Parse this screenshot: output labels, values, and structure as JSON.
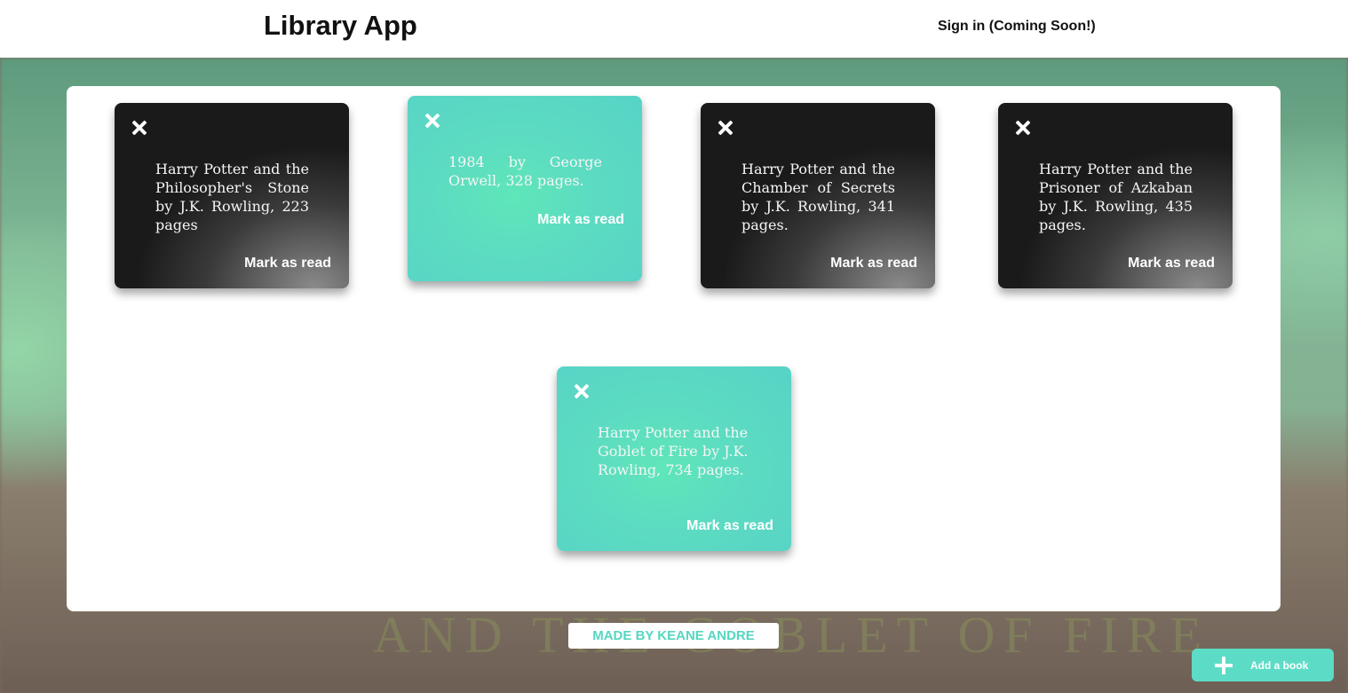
{
  "header": {
    "title": "Library App",
    "sign_in": "Sign in (Coming Soon!)"
  },
  "background": {
    "text": "AND THE GOBLET OF FIRE"
  },
  "books": [
    {
      "text": "Harry Potter and the Philosopher's Stone by J.K. Rowling, 223 pages",
      "action": "Mark as read",
      "status": "unread"
    },
    {
      "text": "1984 by George Orwell, 328 pages.",
      "action": "Mark as read",
      "status": "read"
    },
    {
      "text": "Harry Potter and the Chamber of Secrets by J.K. Rowling, 341 pages.",
      "action": "Mark as read",
      "status": "unread"
    },
    {
      "text": "Harry Potter and the Prisoner of Azkaban by J.K. Rowling, 435 pages.",
      "action": "Mark as read",
      "status": "unread"
    },
    {
      "text": "Harry Potter and the Goblet of Fire by J.K. Rowling, 734 pages.",
      "action": "Mark as read",
      "status": "read"
    }
  ],
  "footer": {
    "credit": "MADE BY KEANE ANDRE"
  },
  "add_book": {
    "label": "Add a book",
    "icon": "plus-icon"
  },
  "colors": {
    "accent": "#5cdcc6",
    "unread_card": "#1a1a1a",
    "read_card": "#5fe6b9"
  }
}
